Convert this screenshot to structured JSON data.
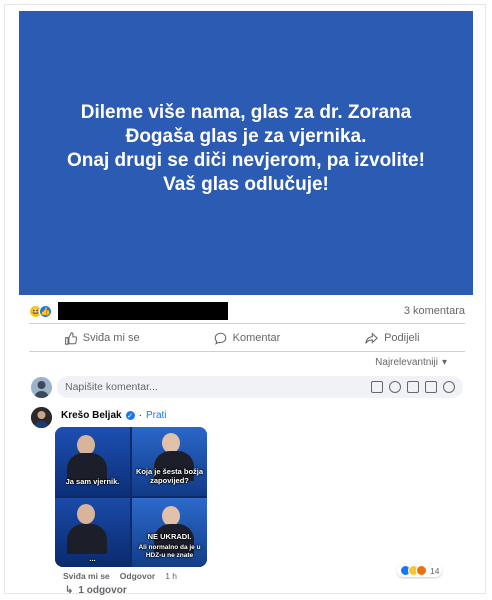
{
  "post": {
    "image_text": [
      "Dileme više nama, glas za dr. Zorana",
      "Đogaša glas je za vjernika.",
      "Onaj drugi se diči nevjerom, pa izvolite!",
      "Vaš glas odlučuje!"
    ],
    "background_color": "#2c5bb3"
  },
  "stats": {
    "comments": "3 komentara"
  },
  "actions": {
    "like": "Sviđa mi se",
    "comment": "Komentar",
    "share": "Podijeli"
  },
  "sort": {
    "label": "Najrelevantniji"
  },
  "composer": {
    "placeholder": "Napišite komentar..."
  },
  "comment": {
    "author": "Krešo Beljak",
    "follow": "Prati",
    "meme_captions": {
      "panel1": "Ja sam vjernik.",
      "panel2": "Koja je šesta božja zapovijed?",
      "panel3": "...",
      "panel4_line1": "NE UKRADI.",
      "panel4_line2": "Ali normalno da je u HDZ-u ne znate"
    },
    "like": "Sviđa mi se",
    "reply": "Odgovor",
    "time": "1 h",
    "reaction_count": "14",
    "replies": "1 odgovor"
  },
  "colors": {
    "accent": "#1877f2",
    "muted": "#65676b"
  }
}
